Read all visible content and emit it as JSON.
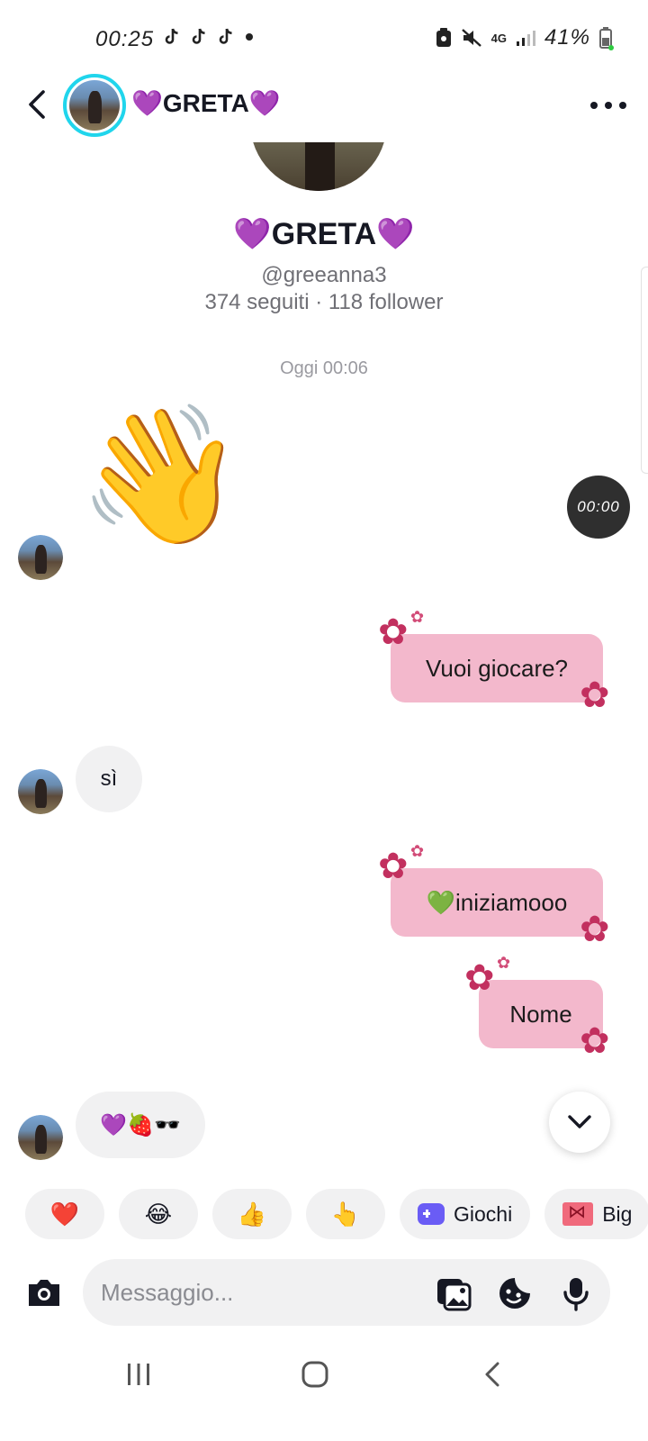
{
  "status_bar": {
    "time": "00:25",
    "left_icons": [
      "tiktok-icon",
      "tiktok-icon",
      "tiktok-icon",
      "dot"
    ],
    "network": "4G",
    "battery": "41%"
  },
  "header": {
    "name": "💜GRETA💜"
  },
  "profile": {
    "name": "💜GRETA💜",
    "handle": "@greeanna3",
    "stats": "374 seguiti · 118 follower"
  },
  "chat": {
    "date_separator": "Oggi 00:06",
    "timer": "00:00",
    "messages": [
      {
        "direction": "in",
        "type": "emoji",
        "text": "👋"
      },
      {
        "direction": "out",
        "type": "text",
        "text": "Vuoi giocare?"
      },
      {
        "direction": "in",
        "type": "text",
        "text": "sì"
      },
      {
        "direction": "out",
        "type": "text",
        "text": "💚iniziamooo"
      },
      {
        "direction": "out",
        "type": "text",
        "text": "Nome"
      },
      {
        "direction": "in",
        "type": "text",
        "text": "💜🍓🕶️"
      }
    ]
  },
  "quick_reactions": {
    "items": [
      {
        "emoji": "❤️"
      },
      {
        "emoji": "😂"
      },
      {
        "emoji": "👍"
      },
      {
        "emoji": "👆"
      },
      {
        "icon": "games-icon",
        "label": "Giochi"
      },
      {
        "icon": "gift-icon",
        "label": "Big"
      }
    ]
  },
  "composer": {
    "placeholder": "Messaggio..."
  },
  "colors": {
    "outgoing_bubble": "#f3b8cc",
    "incoming_bubble": "#f1f1f2",
    "avatar_ring": "#20d5ec",
    "flower": "#c2305f"
  }
}
